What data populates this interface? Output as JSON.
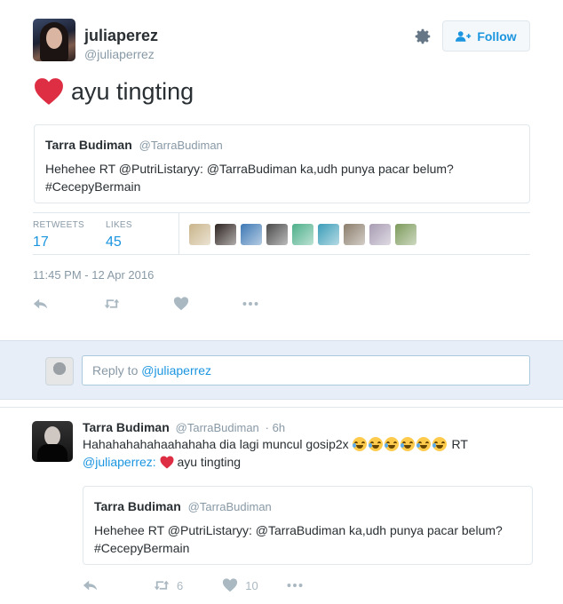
{
  "profile": {
    "fullname": "juliaperez",
    "username": "@juliaperrez",
    "follow_label": "Follow"
  },
  "tweet": {
    "text": "ayu tingting",
    "quote": {
      "name": "Tarra Budiman",
      "username": "@TarraBudiman",
      "body": "Hehehee RT @PutriListaryy: @TarraBudiman ka,udh punya pacar belum? #CecepyBermain"
    },
    "stats": {
      "retweets_label": "RETWEETS",
      "retweets": "17",
      "likes_label": "LIKES",
      "likes": "45"
    },
    "likers": [
      "#c9b48a",
      "#2d2320",
      "#3c78b4",
      "#4a4a4a",
      "#4caf8a",
      "#3a9db8",
      "#8b7d6b",
      "#a89cb3",
      "#7c9a5a"
    ],
    "timestamp": "11:45 PM - 12 Apr 2016"
  },
  "reply_box": {
    "placeholder_prefix": "Reply to ",
    "placeholder_mention": "@juliaperrez"
  },
  "reply_tweet": {
    "name": "Tarra Budiman",
    "username": "@TarraBudiman",
    "time": "· 6h",
    "text_start": "Hahahahahahaahahaha dia lagi muncul gosip2x",
    "emoji_count": 6,
    "text_rt": "RT",
    "mention": "@juliaperrez:",
    "text_end": "ayu tingting",
    "quote": {
      "name": "Tarra Budiman",
      "username": "@TarraBudiman",
      "body": "Hehehee RT @PutriListaryy: @TarraBudiman ka,udh punya pacar belum? #CecepyBermain"
    },
    "retweet_count": "6",
    "like_count": "10"
  },
  "colors": {
    "link": "#1b95e0",
    "heart": "#e0245e",
    "muted": "#8899a6",
    "reply_bg": "#e8eef7"
  }
}
